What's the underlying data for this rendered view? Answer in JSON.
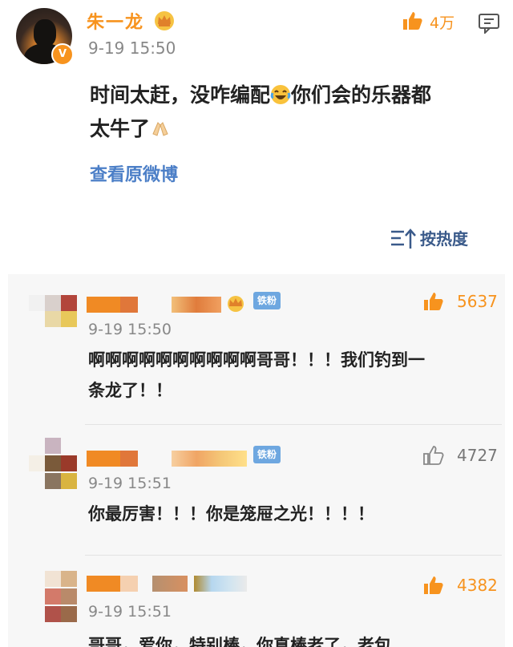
{
  "post": {
    "author": "朱一龙",
    "verified_badge": "V",
    "time": "9-19 15:50",
    "likes": "4万",
    "text_line1": "时间太赶，没咋编配",
    "text_line1_b": "你们会的乐器都",
    "text_line2": "太牛了",
    "view_original": "查看原微博",
    "sort_label": "按热度",
    "accent_color": "#f7931e",
    "link_color": "#4c7fc7"
  },
  "comments": [
    {
      "badge": "铁粉",
      "time": "9-19 15:50",
      "likes": "5637",
      "liked": true,
      "text_line1": "啊啊啊啊啊啊啊啊啊啊哥哥！！！我们钓到一",
      "text_line2": "条龙了！！"
    },
    {
      "badge": "铁粉",
      "time": "9-19 15:51",
      "likes": "4727",
      "liked": false,
      "text_line1": "你最厉害！！！你是笼屉之光！！！！",
      "text_line2": ""
    },
    {
      "badge": "",
      "time": "9-19 15:51",
      "likes": "4382",
      "liked": true,
      "text_line1": "哥哥，爱你，特别棒，你真棒老了，老包",
      "text_line2": ""
    }
  ]
}
